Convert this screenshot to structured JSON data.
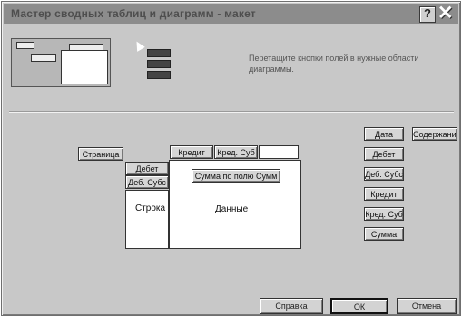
{
  "window": {
    "title": "Мастер сводных таблиц и диаграмм - макет"
  },
  "instruction": "Перетащите кнопки полей в нужные области диаграммы.",
  "layout_fields": {
    "page": "Страница",
    "row_headers": [
      "Дебет",
      "Деб. Субс"
    ],
    "column_headers": [
      "Кредит",
      "Кред. Суб"
    ],
    "data_field": "Сумма по полю Сумм"
  },
  "area_labels": {
    "row": "Строка",
    "data": "Данные"
  },
  "available_fields": [
    "Дата",
    "Содержание",
    "Дебет",
    "Деб. Субс",
    "Кредит",
    "Кред. Суб",
    "Сумма"
  ],
  "buttons": {
    "help": "Справка",
    "ok": "ОК",
    "cancel": "Отмена"
  }
}
